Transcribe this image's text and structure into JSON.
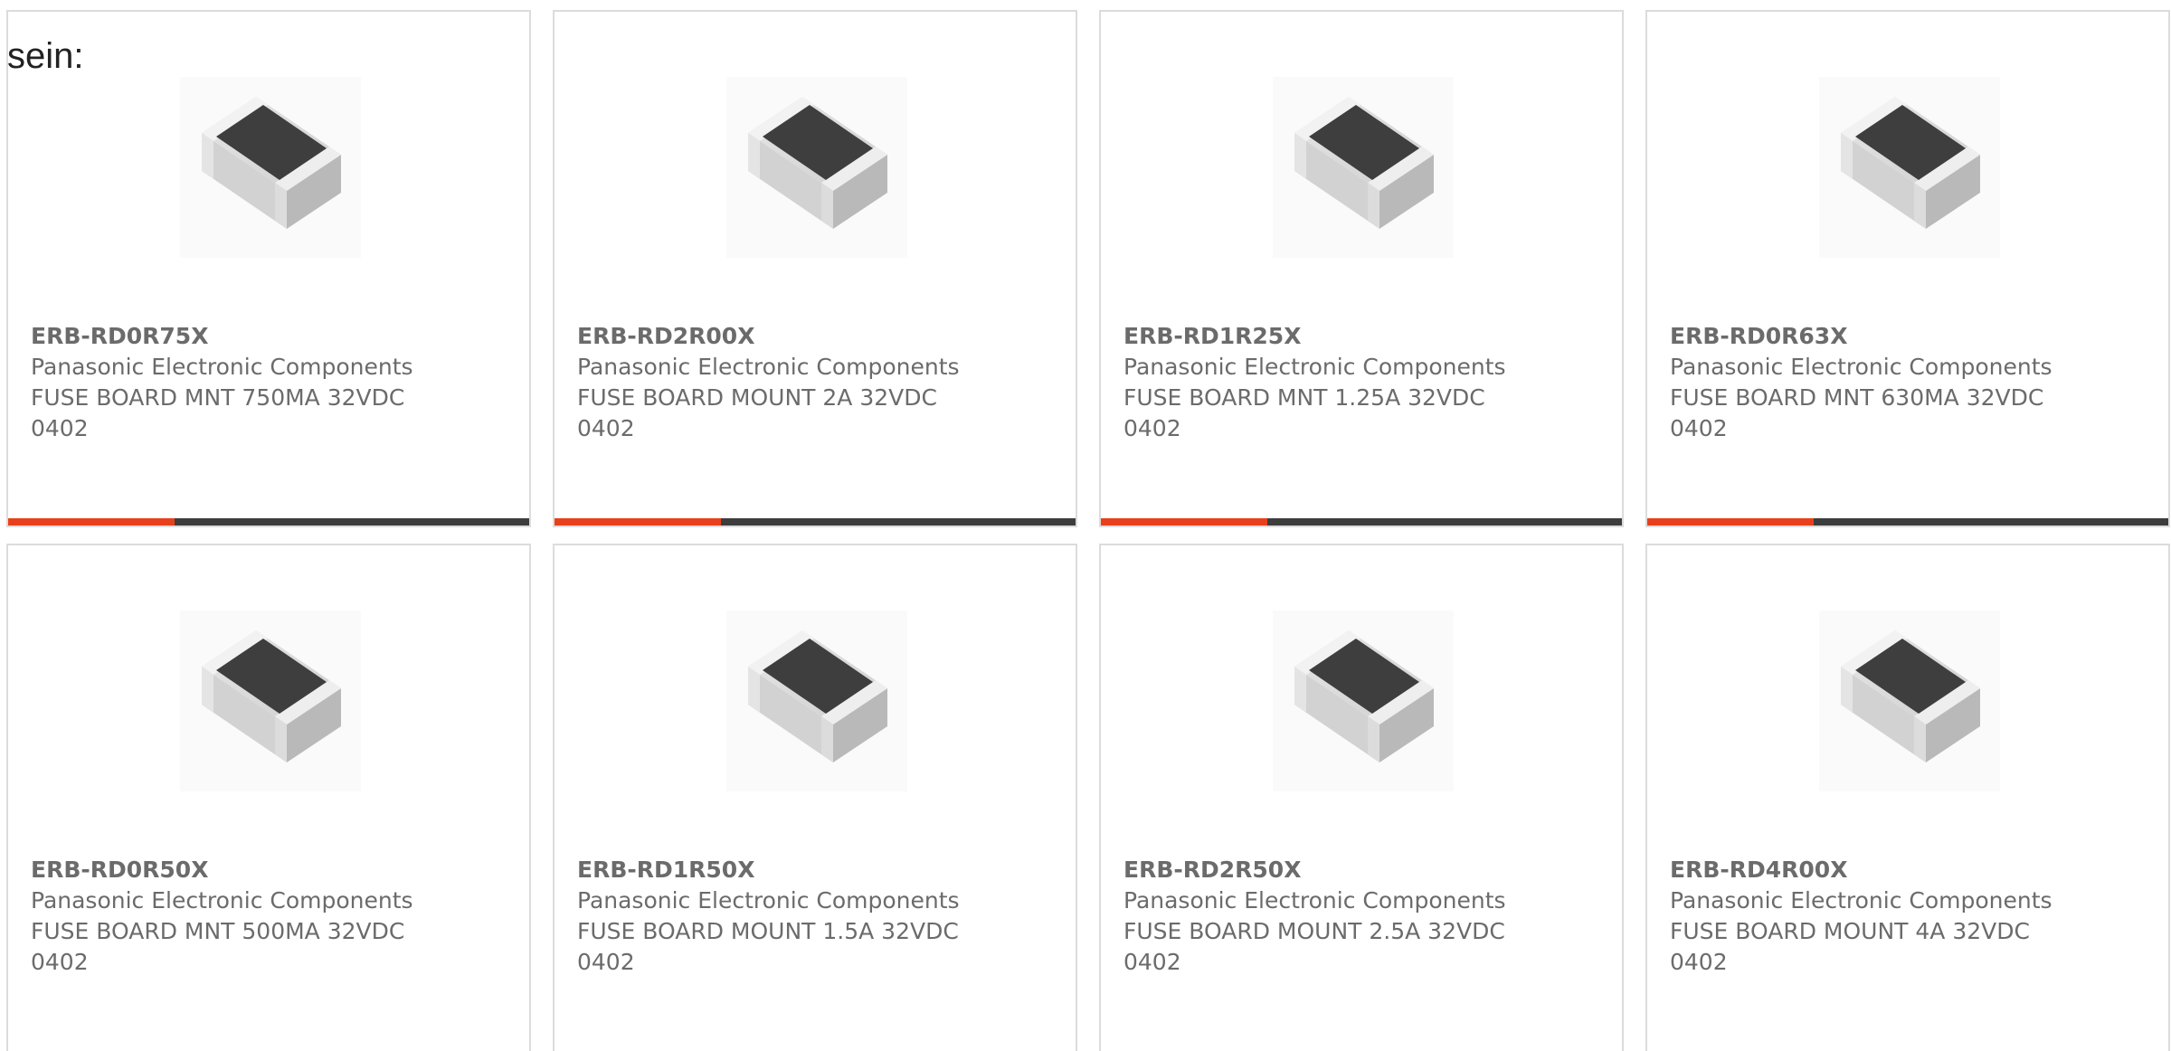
{
  "intro_text": "sein:",
  "colors": {
    "progress_fill": "#e8401c",
    "progress_track": "#3d3d3d",
    "card_border": "#dcdcdc",
    "text": "#6b6b6b"
  },
  "products": [
    {
      "part": "ERB-RD0R75X",
      "manufacturer": "Panasonic Electronic Components",
      "desc1": "FUSE BOARD MNT 750MA 32VDC",
      "desc2": "0402",
      "progress": 0.32
    },
    {
      "part": "ERB-RD2R00X",
      "manufacturer": "Panasonic Electronic Components",
      "desc1": "FUSE BOARD MOUNT 2A 32VDC",
      "desc2": "0402",
      "progress": 0.32
    },
    {
      "part": "ERB-RD1R25X",
      "manufacturer": "Panasonic Electronic Components",
      "desc1": "FUSE BOARD MNT 1.25A 32VDC",
      "desc2": "0402",
      "progress": 0.32
    },
    {
      "part": "ERB-RD0R63X",
      "manufacturer": "Panasonic Electronic Components",
      "desc1": "FUSE BOARD MNT 630MA 32VDC",
      "desc2": "0402",
      "progress": 0.32
    },
    {
      "part": "ERB-RD0R50X",
      "manufacturer": "Panasonic Electronic Components",
      "desc1": "FUSE BOARD MNT 500MA 32VDC",
      "desc2": "0402"
    },
    {
      "part": "ERB-RD1R50X",
      "manufacturer": "Panasonic Electronic Components",
      "desc1": "FUSE BOARD MOUNT 1.5A 32VDC",
      "desc2": "0402"
    },
    {
      "part": "ERB-RD2R50X",
      "manufacturer": "Panasonic Electronic Components",
      "desc1": "FUSE BOARD MOUNT 2.5A 32VDC",
      "desc2": "0402"
    },
    {
      "part": "ERB-RD4R00X",
      "manufacturer": "Panasonic Electronic Components",
      "desc1": "FUSE BOARD MOUNT 4A 32VDC",
      "desc2": "0402"
    }
  ]
}
